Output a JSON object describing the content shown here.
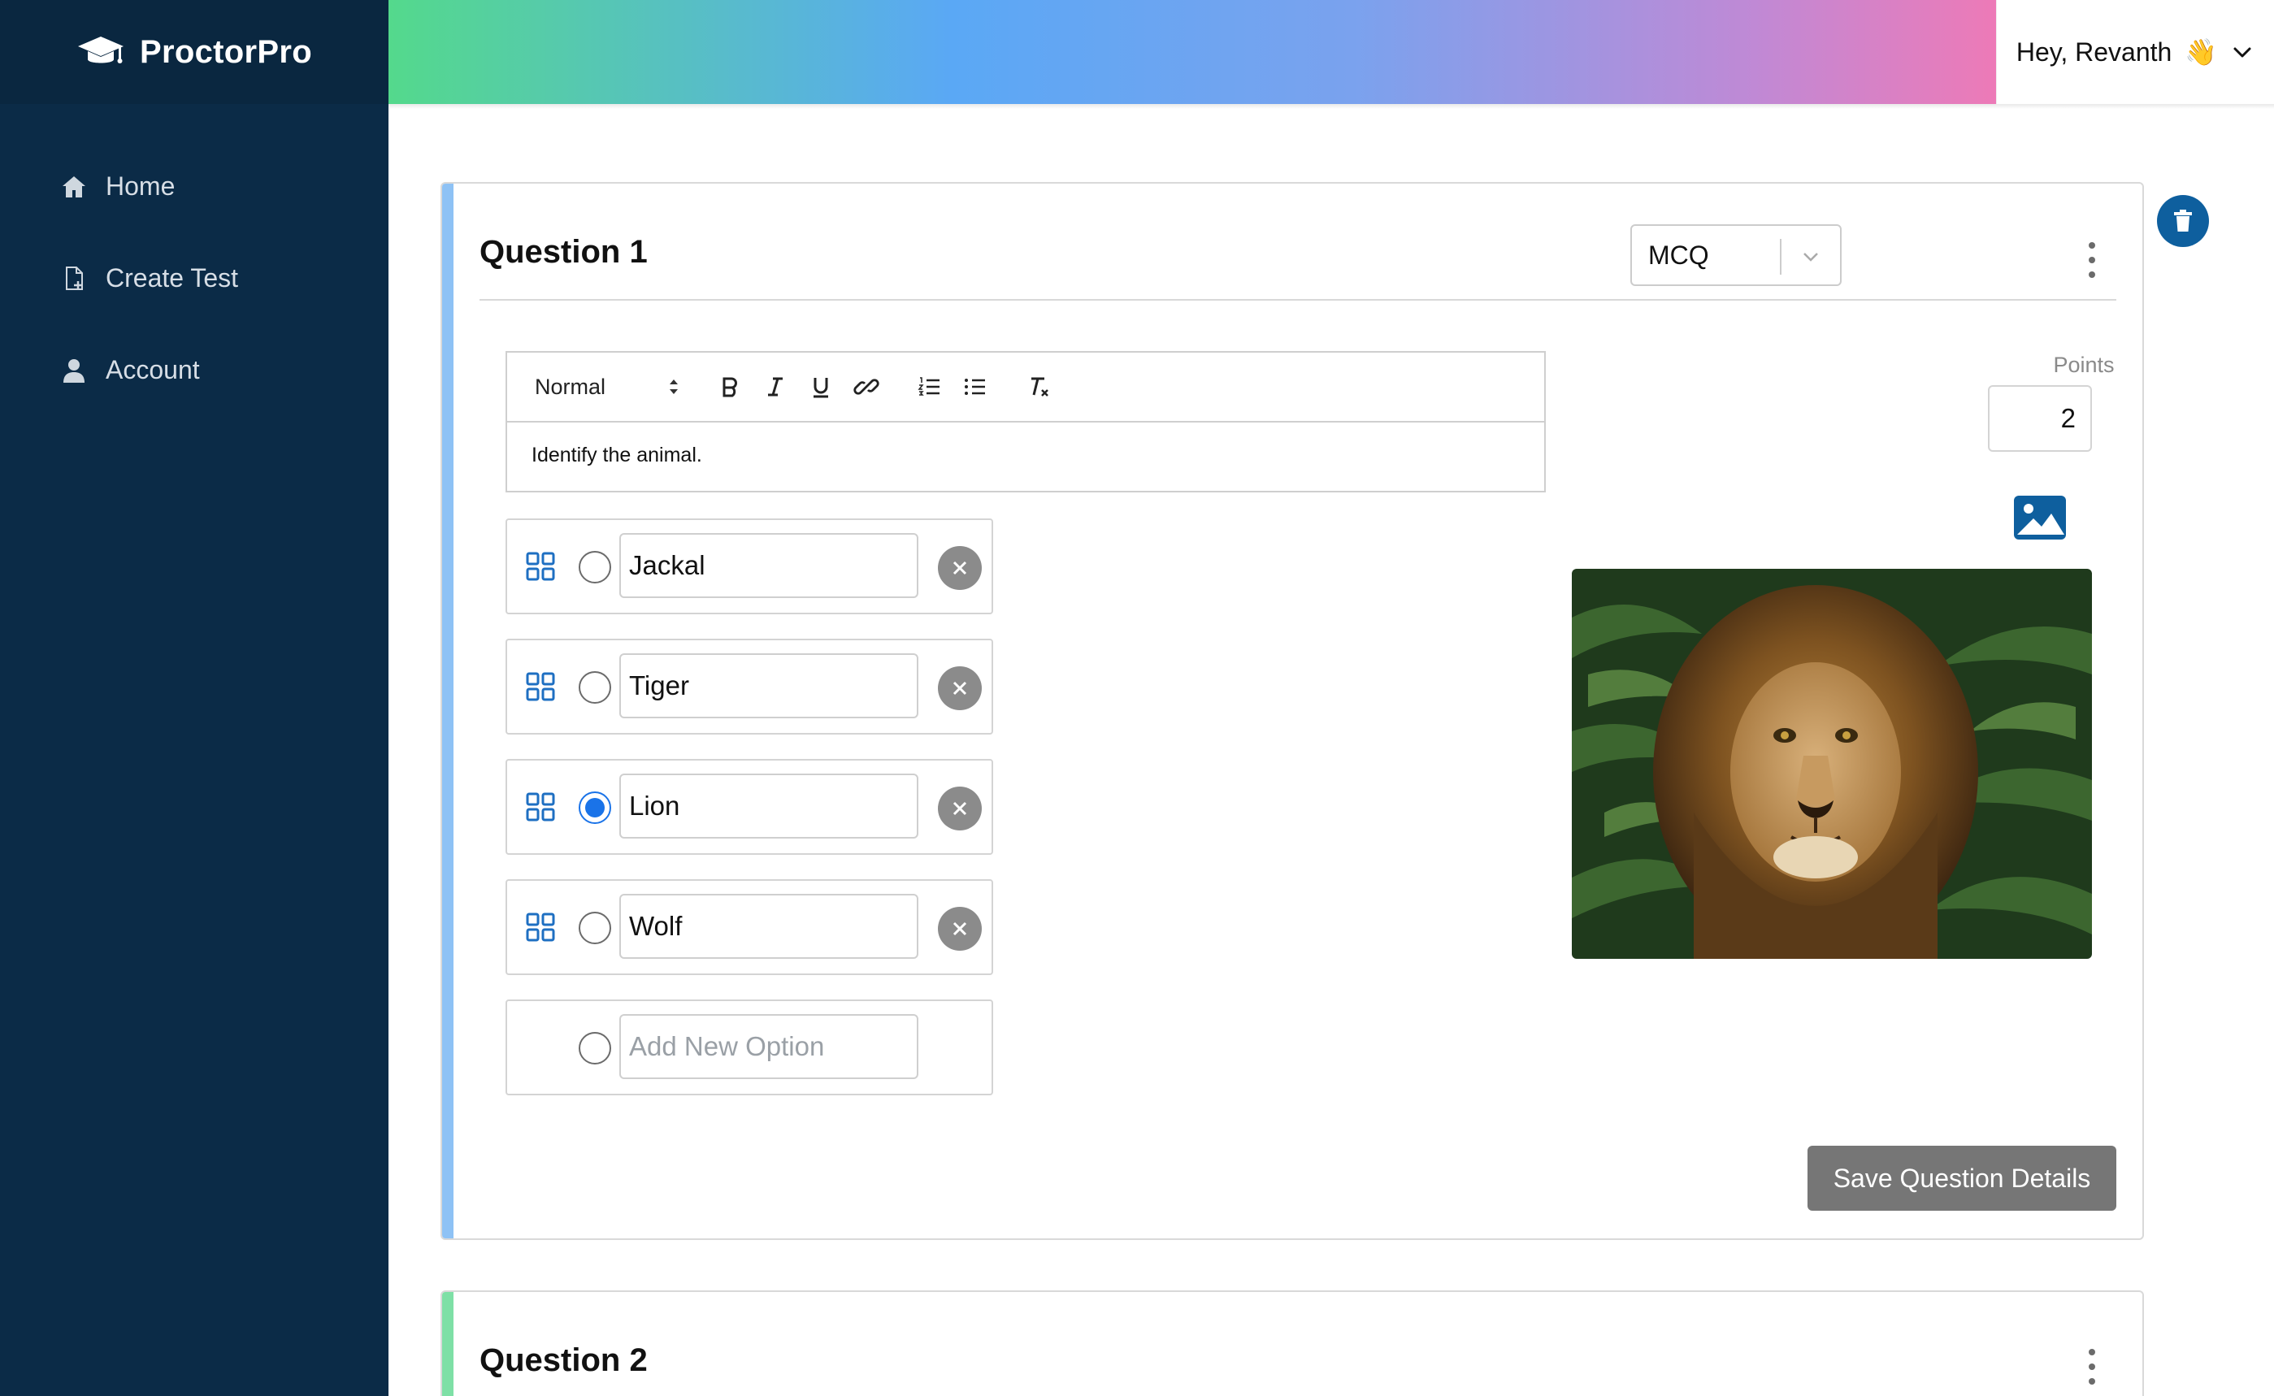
{
  "app": {
    "name": "ProctorPro"
  },
  "sidebar": {
    "items": [
      {
        "label": "Home",
        "icon": "home-icon"
      },
      {
        "label": "Create Test",
        "icon": "file-plus-icon"
      },
      {
        "label": "Account",
        "icon": "user-icon"
      }
    ]
  },
  "header": {
    "greeting": "Hey, Revanth",
    "wave": "👋"
  },
  "questions": [
    {
      "title": "Question 1",
      "type": "MCQ",
      "editor": {
        "format": "Normal",
        "content": "Identify the animal."
      },
      "points_label": "Points",
      "points": "2",
      "options": [
        {
          "label": "Jackal",
          "selected": false
        },
        {
          "label": "Tiger",
          "selected": false
        },
        {
          "label": "Lion",
          "selected": true
        },
        {
          "label": "Wolf",
          "selected": false
        }
      ],
      "new_option_placeholder": "Add New Option",
      "save_label": "Save Question Details",
      "image_alt": "lion photo"
    },
    {
      "title": "Question 2"
    }
  ],
  "colors": {
    "sidebar_bg": "#0b2b47",
    "accent_blue": "#1a73e8",
    "delete_button": "#0e5f9e",
    "save_button": "#767676",
    "question1_accent": "#8ec2f5",
    "question2_accent": "#7ee0a6"
  }
}
